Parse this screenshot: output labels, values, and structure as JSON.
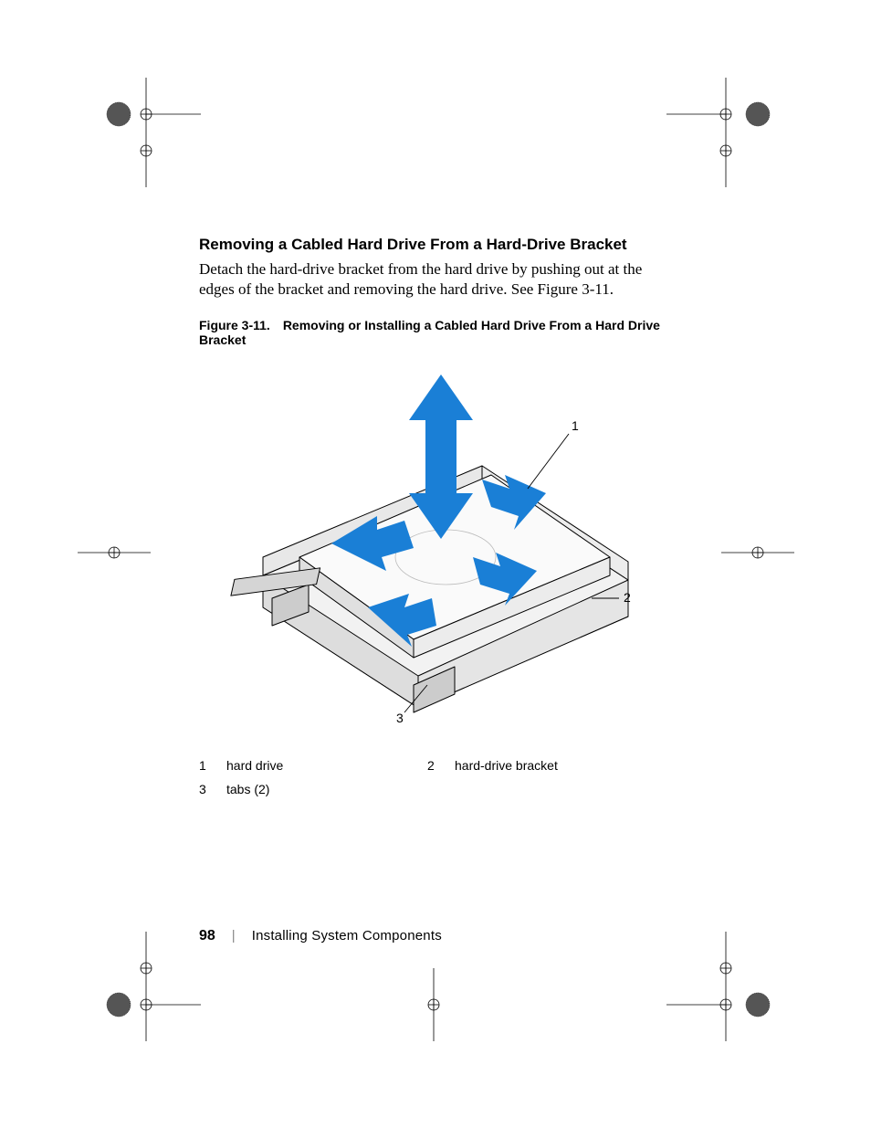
{
  "heading": "Removing a Cabled Hard Drive From a Hard-Drive Bracket",
  "body": "Detach the hard-drive bracket from the hard drive by pushing out at the edges of the bracket and removing the hard drive. See Figure 3-11.",
  "figure": {
    "number": "Figure 3-11.",
    "title": "Removing or Installing a Cabled Hard Drive From a Hard Drive Bracket",
    "callouts": {
      "c1": "1",
      "c2": "2",
      "c3": "3"
    }
  },
  "legend": {
    "n1": "1",
    "l1": "hard drive",
    "n2": "2",
    "l2": "hard-drive bracket",
    "n3": "3",
    "l3": "tabs (2)"
  },
  "footer": {
    "page": "98",
    "separator": "|",
    "title": "Installing System Components"
  }
}
